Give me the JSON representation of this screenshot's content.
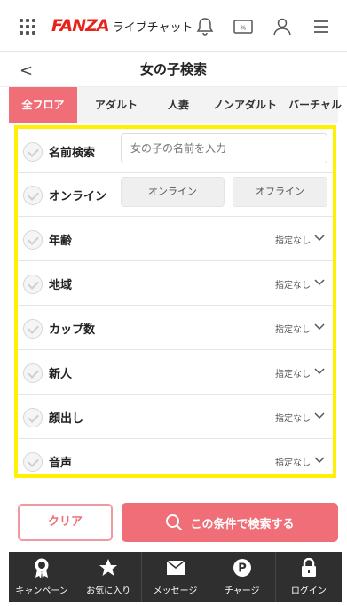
{
  "header": {
    "brand": "FANZA",
    "service": "ライブチャット",
    "icons": [
      "menu-grid-icon",
      "bell-icon",
      "coupon-icon",
      "user-icon",
      "hamburger-icon"
    ]
  },
  "titlebar": {
    "back": "<",
    "title": "女の子検索"
  },
  "tabs": [
    {
      "label": "全フロア",
      "active": true
    },
    {
      "label": "アダルト"
    },
    {
      "label": "人妻"
    },
    {
      "label": "ノンアダルト"
    },
    {
      "label": "バーチャル"
    }
  ],
  "filters": {
    "name": {
      "label": "名前検索",
      "placeholder": "女の子の名前を入力"
    },
    "online": {
      "label": "オンライン",
      "on_label": "オンライン",
      "off_label": "オフライン"
    },
    "age": {
      "label": "年齢",
      "value": "指定なし"
    },
    "region": {
      "label": "地域",
      "value": "指定なし"
    },
    "cup": {
      "label": "カップ数",
      "value": "指定なし"
    },
    "newcomer": {
      "label": "新人",
      "value": "指定なし"
    },
    "face": {
      "label": "顔出し",
      "value": "指定なし"
    },
    "voice": {
      "label": "音声",
      "value": "指定なし"
    }
  },
  "actions": {
    "clear": "クリア",
    "search": "この条件で検索する"
  },
  "colors": {
    "accent": "#ef6e77",
    "highlight": "#fff200",
    "brand": "#e8211b",
    "nav_bg": "#2f2f2f"
  },
  "bottom_nav": [
    {
      "label": "キャンペーン",
      "icon": "award-icon"
    },
    {
      "label": "お気に入り",
      "icon": "star-icon"
    },
    {
      "label": "メッセージ",
      "icon": "mail-icon"
    },
    {
      "label": "チャージ",
      "icon": "point-icon"
    },
    {
      "label": "ログイン",
      "icon": "lock-icon"
    }
  ]
}
